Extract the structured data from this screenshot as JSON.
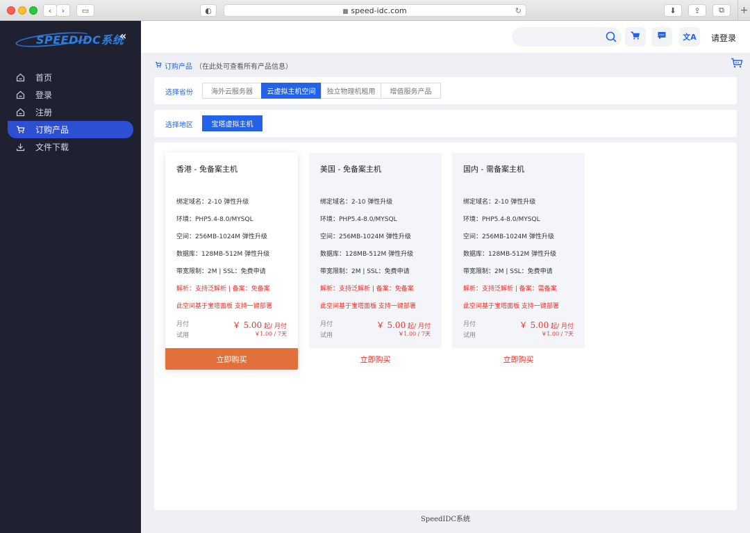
{
  "browser": {
    "url": "speed-idc.com"
  },
  "sidebar": {
    "logo_text": "SPEEDIDC系统",
    "items": [
      {
        "label": "首页",
        "icon": "home-icon"
      },
      {
        "label": "登录",
        "icon": "home-icon"
      },
      {
        "label": "注册",
        "icon": "home-icon"
      },
      {
        "label": "订购产品",
        "icon": "cart-icon",
        "active": true
      },
      {
        "label": "文件下载",
        "icon": "download-icon"
      }
    ]
  },
  "header": {
    "login_label": "请登录"
  },
  "breadcrumb": {
    "title": "订购产品",
    "note": "（在此处可查看所有产品信息）"
  },
  "category": {
    "label": "选择省份",
    "tabs": [
      "海外云服务器",
      "云虚拟主机空间",
      "独立物理机租用",
      "增值服务产品"
    ],
    "active_index": 1
  },
  "region": {
    "label": "选择地区",
    "tabs": [
      "宝塔虚拟主机"
    ],
    "active_index": 0
  },
  "products": [
    {
      "title": "香港 - 免备案主机",
      "lines": [
        "绑定域名：2-10 弹性升级",
        "环境：PHP5.4-8.0/MYSQL",
        "空间：256MB-1024M 弹性升级",
        "数据库：128MB-512M 弹性升级",
        "带宽限制：2M | SSL：免费申请"
      ],
      "red_lines": [
        "解析：支持泛解析 | 备案：免备案",
        "此空间基于宝塔面板 支持一键部署"
      ],
      "monthly_label": "月付",
      "monthly_price": "￥ 5.00",
      "monthly_suffix": "起/ 月付",
      "trial_label": "试用",
      "trial_price": "￥1.00 / 7天",
      "buy_label": "立即购买",
      "featured": true
    },
    {
      "title": "美国 - 免备案主机",
      "lines": [
        "绑定域名：2-10 弹性升级",
        "环境：PHP5.4-8.0/MYSQL",
        "空间：256MB-1024M 弹性升级",
        "数据库：128MB-512M 弹性升级",
        "带宽限制：2M | SSL：免费申请"
      ],
      "red_lines": [
        "解析：支持泛解析 | 备案：免备案",
        "此空间基于宝塔面板 支持一键部署"
      ],
      "monthly_label": "月付",
      "monthly_price": "￥ 5.00",
      "monthly_suffix": "起/ 月付",
      "trial_label": "试用",
      "trial_price": "￥1.00 / 7天",
      "buy_label": "立即购买",
      "featured": false
    },
    {
      "title": "国内 - 需备案主机",
      "lines": [
        "绑定域名：2-10 弹性升级",
        "环境：PHP5.4-8.0/MYSQL",
        "空间：256MB-1024M 弹性升级",
        "数据库：128MB-512M 弹性升级",
        "带宽限制：2M | SSL：免费申请"
      ],
      "red_lines": [
        "解析：支持泛解析 | 备案：需备案",
        "此空间基于宝塔面板 支持一键部署"
      ],
      "monthly_label": "月付",
      "monthly_price": "￥ 5.00",
      "monthly_suffix": "起/ 月付",
      "trial_label": "试用",
      "trial_price": "￥1.00 / 7天",
      "buy_label": "立即购买",
      "featured": false
    }
  ],
  "footer": {
    "text": "SpeedIDC系统"
  },
  "colors": {
    "accent": "#2463e8",
    "sidebar_bg": "#1f2130",
    "active_item": "#2d4fd4",
    "price_red": "#e8322b",
    "featured_button": "#e2703d"
  }
}
